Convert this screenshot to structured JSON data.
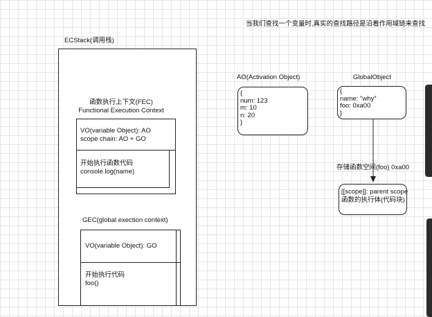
{
  "header_note": "当我们查找一个变量时,真实的查找路径是沿着作用域链来查找",
  "ecstack": {
    "title": "ECStack(调用栈)"
  },
  "fec": {
    "title_cn": "函数执行上下文(FEC)",
    "title_en": "Functional Execution Context",
    "vo_lines": [
      "VO(variable Object): AO",
      "scope chain: AO + GO"
    ],
    "code_lines": [
      "开始执行函数代码",
      "console.log(name)"
    ]
  },
  "gec": {
    "title": "GEC(global exection context)",
    "vo_line": "VO(variable Object): GO",
    "code_lines": [
      "开始执行代码",
      "foo()"
    ]
  },
  "ao": {
    "title": "AO(Activation Object)",
    "lines": [
      "{",
      "num: 123",
      "m: 10",
      "n: 20",
      "}"
    ]
  },
  "global_object": {
    "title": "GlobalObject",
    "lines": [
      "{",
      "name: \"why\"",
      "foo: 0xa00",
      "}"
    ]
  },
  "func_storage": {
    "label": "存储函数空间(foo) 0xa00",
    "lines": [
      "[[scope]]: parent scope",
      "函数的执行体(代码块)"
    ]
  },
  "colors": {
    "grid": "#e6e6e6",
    "stroke": "#222222",
    "handle": "#2c2c2c"
  }
}
